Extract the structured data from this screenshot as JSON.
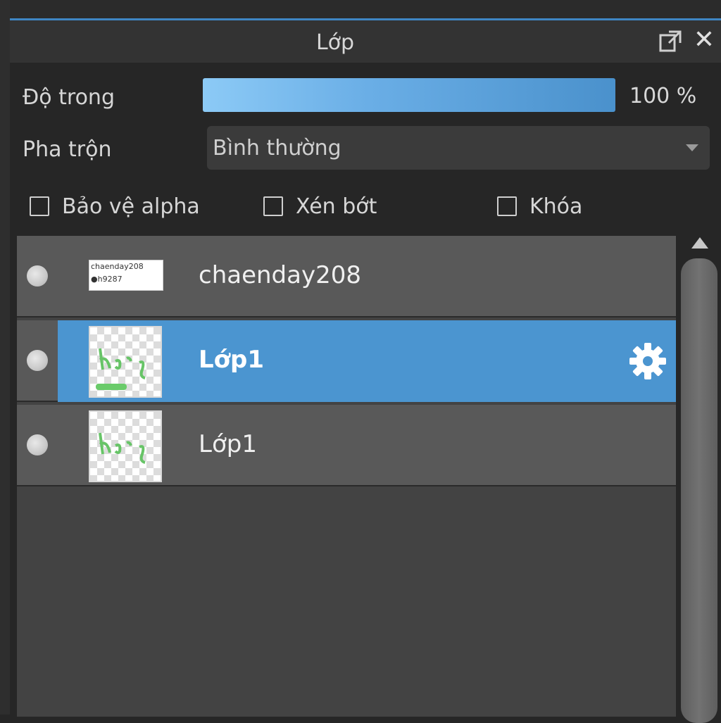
{
  "panel": {
    "title": "Lớp"
  },
  "opacity": {
    "label": "Độ trong",
    "value": "100 %",
    "fraction": 1.0
  },
  "blend": {
    "label": "Pha trộn",
    "value": "Bình thường"
  },
  "options": [
    {
      "label": "Bảo vệ alpha",
      "checked": false
    },
    {
      "label": "Xén bớt",
      "checked": false
    },
    {
      "label": "Khóa",
      "checked": false
    }
  ],
  "layers": [
    {
      "name": "chaenday208",
      "selected": false,
      "thumbnail_text": "chaenday208 ●h9287"
    },
    {
      "name": "Lớp1",
      "selected": true
    },
    {
      "name": "Lớp1",
      "selected": false
    }
  ],
  "icons": {
    "undock": "undock-icon",
    "close": "close-icon",
    "settings": "gear-icon",
    "scroll_up": "arrow-up-icon"
  },
  "colors": {
    "accent": "#4b95d0",
    "opacity_bar_start": "#8ccaf6",
    "opacity_bar_end": "#4a91cc",
    "panel_bg": "#262626",
    "row_bg": "#595959"
  }
}
